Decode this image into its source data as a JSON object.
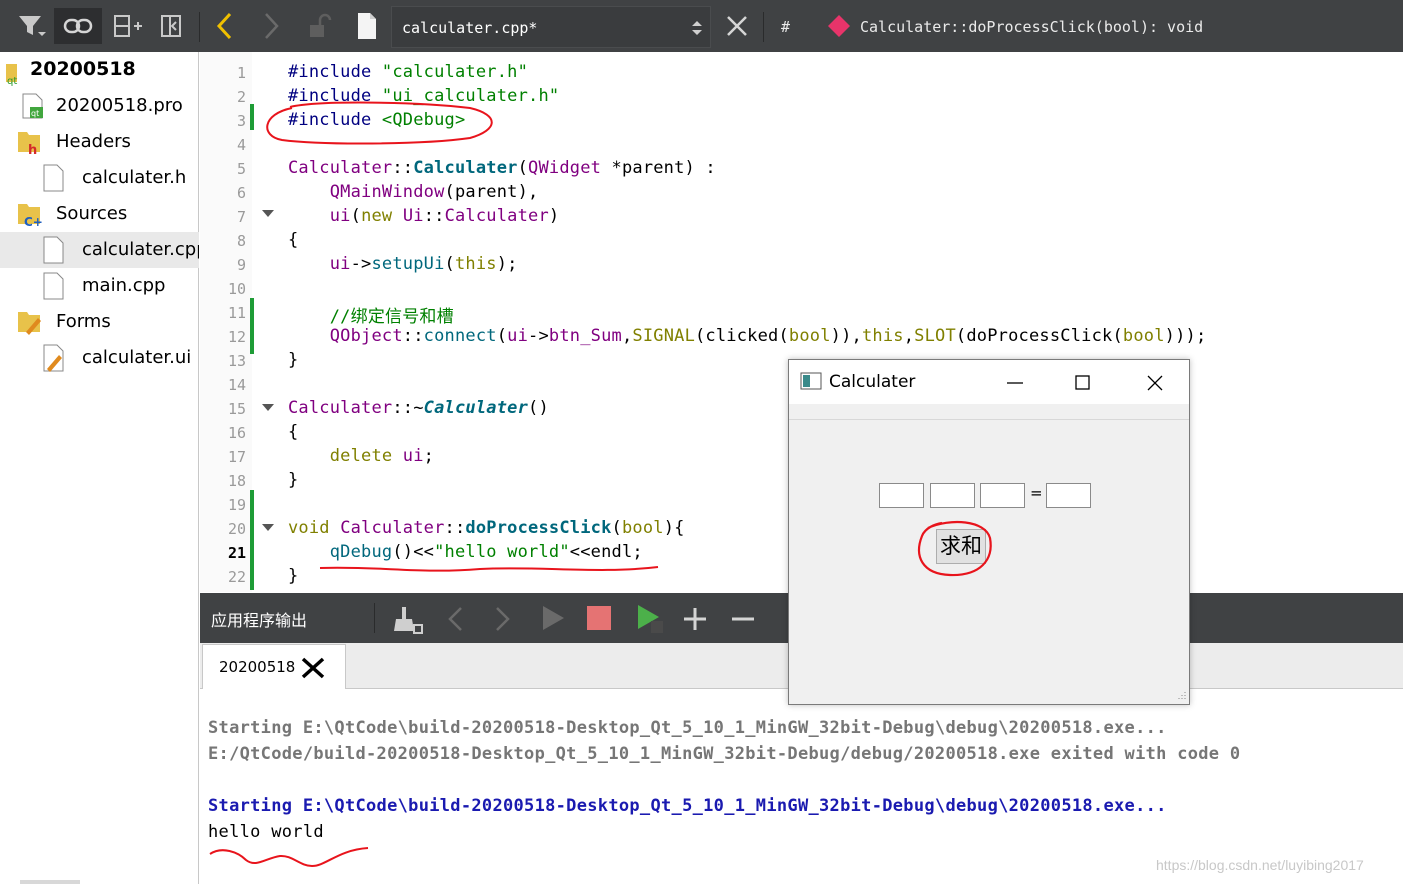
{
  "toolbar": {
    "file_name": "calculater.cpp*",
    "symbol_hash": "#",
    "symbol": "Calculater::doProcessClick(bool): void"
  },
  "project": {
    "root": "20200518",
    "items": [
      {
        "label": "20200518.pro"
      },
      {
        "label": "Headers"
      },
      {
        "label": "calculater.h"
      },
      {
        "label": "Sources"
      },
      {
        "label": "calculater.cpp"
      },
      {
        "label": "main.cpp"
      },
      {
        "label": "Forms"
      },
      {
        "label": "calculater.ui"
      }
    ]
  },
  "editor": {
    "line_numbers": [
      "1",
      "2",
      "3",
      "4",
      "5",
      "6",
      "7",
      "8",
      "9",
      "10",
      "11",
      "12",
      "13",
      "14",
      "15",
      "16",
      "17",
      "18",
      "19",
      "20",
      "21",
      "22"
    ],
    "current_line": "21"
  },
  "output": {
    "title": "应用程序输出",
    "tab": "20200518",
    "lines": [
      "Starting E:\\QtCode\\build-20200518-Desktop_Qt_5_10_1_MinGW_32bit-Debug\\debug\\20200518.exe...",
      "E:/QtCode/build-20200518-Desktop_Qt_5_10_1_MinGW_32bit-Debug/debug/20200518.exe exited with code 0",
      "Starting E:\\QtCode\\build-20200518-Desktop_Qt_5_10_1_MinGW_32bit-Debug\\debug\\20200518.exe...",
      "hello world"
    ]
  },
  "calc_window": {
    "title": "Calculater",
    "equals": "=",
    "sum_button": "求和"
  },
  "watermark": "https://blog.csdn.net/luyibing2017",
  "colors": {
    "toolbar_bg": "#404244",
    "change_marker": "#1e9c36",
    "annotation": "#e8141c"
  }
}
